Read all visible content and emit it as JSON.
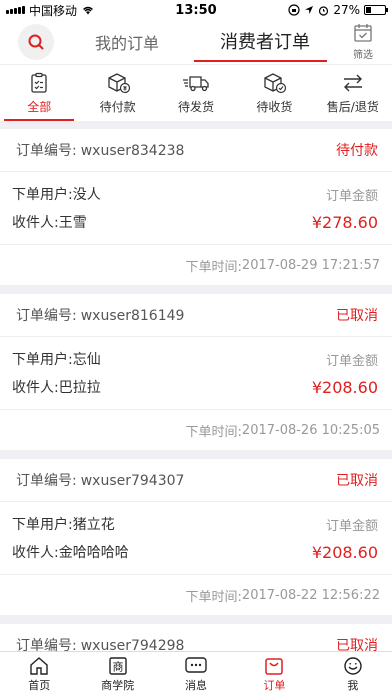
{
  "status_bar": {
    "carrier": "中国移动",
    "time": "13:50",
    "battery": "27%",
    "battery_level": 0.27
  },
  "header": {
    "tab_my_orders": "我的订单",
    "tab_consumer_orders": "消费者订单",
    "filter_label": "筛选"
  },
  "status_tabs": [
    {
      "label": "全部",
      "icon": "clipboard-icon",
      "active": true
    },
    {
      "label": "待付款",
      "icon": "wallet-box-icon",
      "active": false
    },
    {
      "label": "待发货",
      "icon": "truck-icon",
      "active": false
    },
    {
      "label": "待收货",
      "icon": "box-check-icon",
      "active": false
    },
    {
      "label": "售后/退货",
      "icon": "exchange-arrows-icon",
      "active": false
    }
  ],
  "order_labels": {
    "order_no": "订单编号:",
    "buyer": "下单用户:",
    "receiver": "收件人:",
    "amount": "订单金额",
    "time": "下单时间:"
  },
  "orders": [
    {
      "order_no": "wxuser834238",
      "status": "待付款",
      "buyer": "没人",
      "receiver": "王雪",
      "amount": "¥278.60",
      "time": "2017-08-29 17:21:57"
    },
    {
      "order_no": "wxuser816149",
      "status": "已取消",
      "buyer": "忘仙",
      "receiver": "巴拉拉",
      "amount": "¥208.60",
      "time": "2017-08-26 10:25:05"
    },
    {
      "order_no": "wxuser794307",
      "status": "已取消",
      "buyer": "猪立花",
      "receiver": "金哈哈哈哈",
      "amount": "¥208.60",
      "time": "2017-08-22 12:56:22"
    },
    {
      "order_no": "wxuser794298",
      "status": "已取消"
    }
  ],
  "tabbar": [
    {
      "label": "首页",
      "icon": "home-icon",
      "active": false
    },
    {
      "label": "商学院",
      "icon": "academy-icon",
      "active": false
    },
    {
      "label": "消息",
      "icon": "message-icon",
      "active": false
    },
    {
      "label": "订单",
      "icon": "order-bag-icon",
      "active": true
    },
    {
      "label": "我",
      "icon": "smile-face-icon",
      "active": false
    }
  ]
}
